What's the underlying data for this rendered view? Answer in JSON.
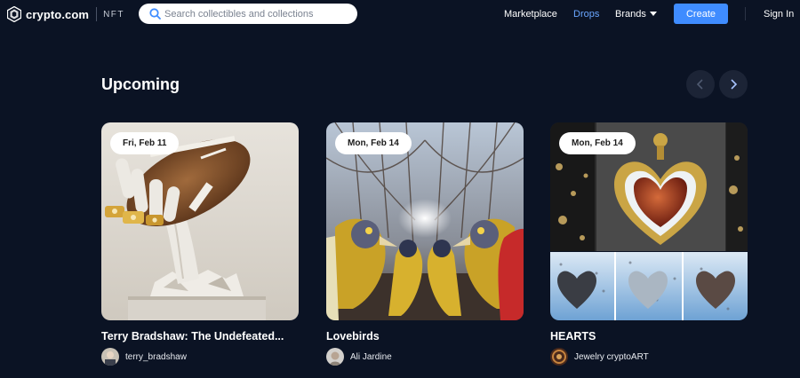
{
  "brand": {
    "name": "crypto.com",
    "sub": "NFT"
  },
  "search": {
    "placeholder": "Search collectibles and collections"
  },
  "nav": {
    "marketplace": "Marketplace",
    "drops": "Drops",
    "brands": "Brands",
    "create": "Create",
    "signin": "Sign In"
  },
  "section": {
    "title": "Upcoming"
  },
  "cards": [
    {
      "date": "Fri, Feb 11",
      "title": "Terry Bradshaw: The Undefeated...",
      "creator": "terry_bradshaw",
      "image": "football-hand-sculpture"
    },
    {
      "date": "Mon, Feb 14",
      "title": "Lovebirds",
      "creator": "Ali Jardine",
      "image": "mirrored-birds"
    },
    {
      "date": "Mon, Feb 14",
      "title": "HEARTS",
      "creator": "Jewelry cryptoART",
      "image": "jeweled-hearts"
    }
  ],
  "colors": {
    "background": "#0b1324",
    "accent": "#3f8cff",
    "active_link": "#6aa6ff"
  }
}
